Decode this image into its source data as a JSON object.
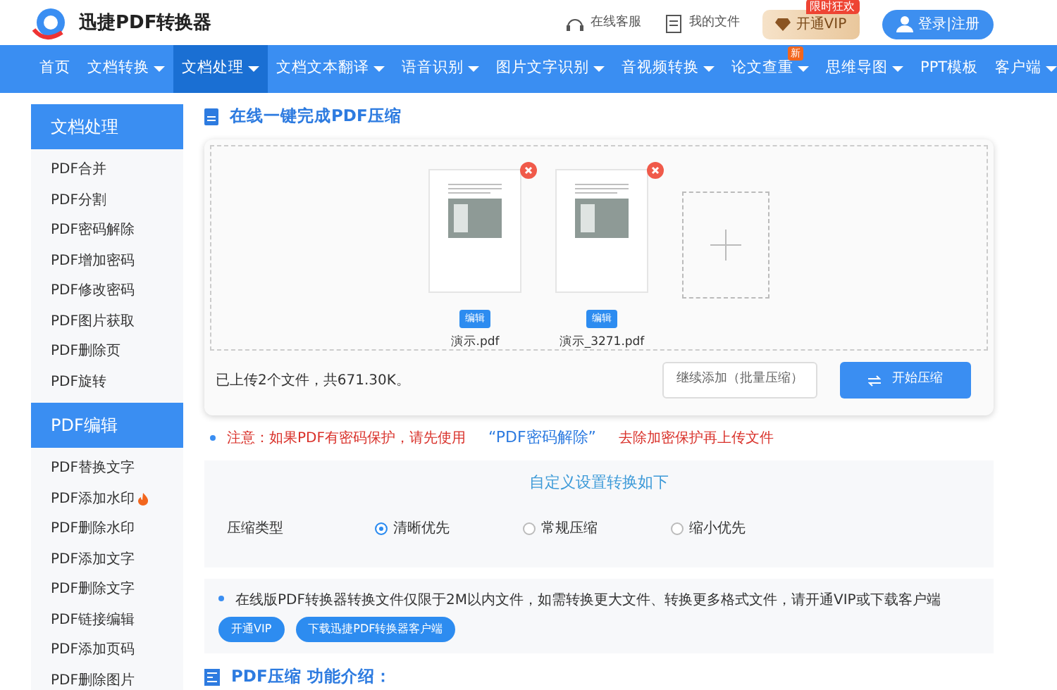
{
  "header": {
    "logo_text": "迅捷PDF转换器",
    "links": [
      "在线客服",
      "我的文件"
    ],
    "vip_button": "开通VIP",
    "vip_badge": "限时狂欢",
    "login_button": "登录|注册"
  },
  "nav": [
    {
      "label": "首页",
      "dropdown": false,
      "selected": false
    },
    {
      "label": "文档转换",
      "dropdown": true,
      "selected": false
    },
    {
      "label": "文档处理",
      "dropdown": true,
      "selected": true
    },
    {
      "label": "文档文本翻译",
      "dropdown": true,
      "selected": false
    },
    {
      "label": "语音识别",
      "dropdown": true,
      "selected": false
    },
    {
      "label": "图片文字识别",
      "dropdown": true,
      "selected": false
    },
    {
      "label": "音视频转换",
      "dropdown": true,
      "selected": false
    },
    {
      "label": "论文查重",
      "dropdown": true,
      "selected": false,
      "badge": "新"
    },
    {
      "label": "思维导图",
      "dropdown": true,
      "selected": false
    },
    {
      "label": "PPT模板",
      "dropdown": false,
      "selected": false
    },
    {
      "label": "客户端",
      "dropdown": true,
      "selected": false
    }
  ],
  "sidebar": [
    {
      "title": "文档处理",
      "items": [
        {
          "label": "PDF合并",
          "hot": false
        },
        {
          "label": "PDF分割",
          "hot": false
        },
        {
          "label": "PDF密码解除",
          "hot": false
        },
        {
          "label": "PDF增加密码",
          "hot": false
        },
        {
          "label": "PDF修改密码",
          "hot": false
        },
        {
          "label": "PDF图片获取",
          "hot": false
        },
        {
          "label": "PDF删除页",
          "hot": false
        },
        {
          "label": "PDF旋转",
          "hot": false
        }
      ]
    },
    {
      "title": "PDF编辑",
      "items": [
        {
          "label": "PDF替换文字",
          "hot": false
        },
        {
          "label": "PDF添加水印",
          "hot": true
        },
        {
          "label": "PDF删除水印",
          "hot": false
        },
        {
          "label": "PDF添加文字",
          "hot": false
        },
        {
          "label": "PDF删除文字",
          "hot": false
        },
        {
          "label": "PDF链接编辑",
          "hot": false
        },
        {
          "label": "PDF添加页码",
          "hot": false
        },
        {
          "label": "PDF删除图片",
          "hot": false
        }
      ]
    }
  ],
  "main": {
    "title": "在线一键完成PDF压缩",
    "files": [
      {
        "name": "演示.pdf",
        "edit_button": "编辑"
      },
      {
        "name": "演示_3271.pdf",
        "edit_button": "编辑"
      }
    ],
    "upload_summary": "已上传2个文件，共671.30K。",
    "add_button": "继续添加（批量压缩）",
    "start_button": "开始压缩",
    "notice": {
      "prefix": "注意：如果PDF有密码保护，请先使用",
      "link": "“PDF密码解除”",
      "suffix": "去除加密保护再上传文件"
    },
    "settings": {
      "title": "自定义设置转换如下",
      "label": "压缩类型",
      "options": [
        {
          "label": "清晰优先",
          "selected": true
        },
        {
          "label": "常规压缩",
          "selected": false
        },
        {
          "label": "缩小优先",
          "selected": false
        }
      ]
    },
    "limit": {
      "text": "在线版PDF转换器转换文件仅限于2M以内文件，如需转换更大文件、转换更多格式文件，请开通VIP或下载客户端",
      "buttons": [
        "开通VIP",
        "下载迅捷PDF转换器客户端"
      ]
    },
    "intro_title": "PDF压缩 功能介绍："
  }
}
